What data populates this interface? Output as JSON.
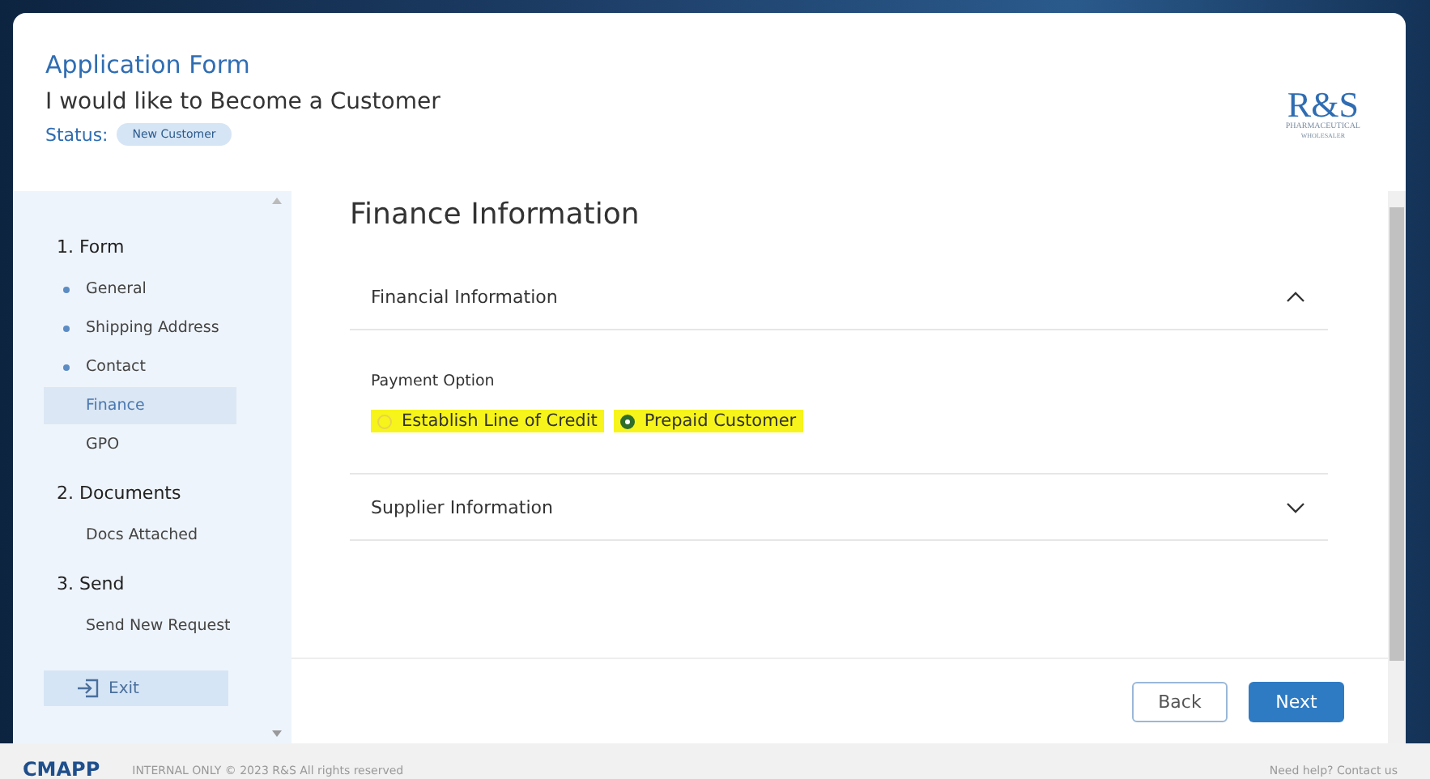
{
  "header": {
    "title": "Application Form",
    "subtitle": "I would like to Become a Customer",
    "status_label": "Status:",
    "status": "New Customer"
  },
  "logo": {
    "mark": "R&S",
    "line1": "PHARMACEUTICAL",
    "line2": "WHOLESALER"
  },
  "sidebar": {
    "sections": [
      {
        "title": "1. Form",
        "items": [
          {
            "label": "General",
            "completed": true,
            "selected": false
          },
          {
            "label": "Shipping Address",
            "completed": true,
            "selected": false
          },
          {
            "label": "Contact",
            "completed": true,
            "selected": false
          },
          {
            "label": "Finance",
            "completed": false,
            "selected": true
          },
          {
            "label": "GPO",
            "completed": false,
            "selected": false
          }
        ]
      },
      {
        "title": "2. Documents",
        "items": [
          {
            "label": "Docs Attached",
            "completed": false,
            "selected": false
          }
        ]
      },
      {
        "title": "3. Send",
        "items": [
          {
            "label": "Send New Request",
            "completed": false,
            "selected": false
          }
        ]
      }
    ],
    "exit": "Exit"
  },
  "page_title": "Finance Information",
  "panels": [
    {
      "title": "Financial Information",
      "expanded": true,
      "field_label": "Payment Option",
      "options": [
        {
          "label": "Establish Line of Credit",
          "selected": false,
          "highlighted": true
        },
        {
          "label": "Prepaid Customer",
          "selected": true,
          "highlighted": true
        }
      ]
    },
    {
      "title": "Supplier Information",
      "expanded": false
    }
  ],
  "buttons": {
    "back": "Back",
    "next": "Next"
  },
  "footer": {
    "brand": "CMAPP",
    "notice": "INTERNAL ONLY © 2023 R&S All rights reserved",
    "help": "Need help? Contact us"
  }
}
